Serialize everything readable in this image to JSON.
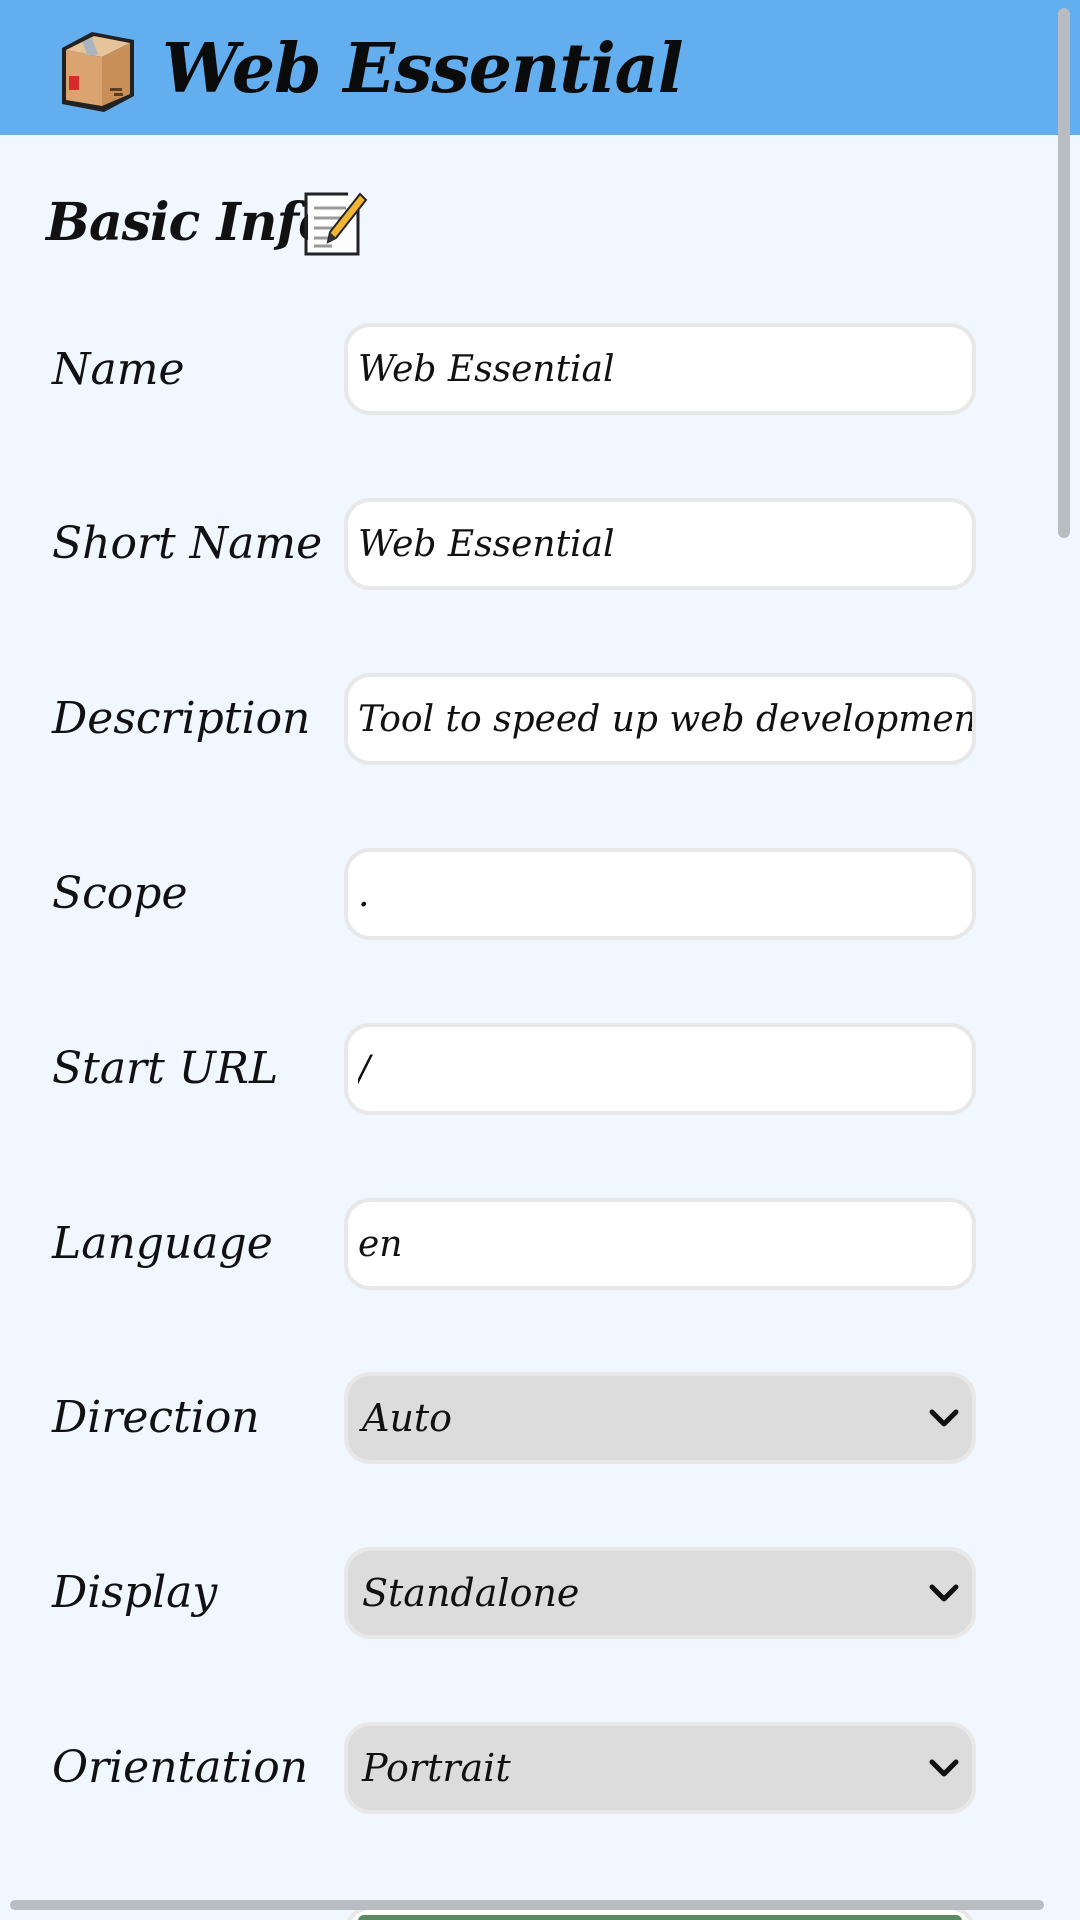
{
  "app": {
    "title": "Web Essential",
    "header_color": "#62aeee",
    "background_color": "#f0f7ff",
    "logo_icon": "package-box-icon"
  },
  "section": {
    "title": "Basic Info",
    "icon": "memo-pencil-icon"
  },
  "fields": {
    "name": {
      "label": "Name",
      "value": "Web Essential"
    },
    "short_name": {
      "label": "Short Name",
      "value": "Web Essential"
    },
    "description": {
      "label": "Description",
      "value": "Tool to speed up web development"
    },
    "scope": {
      "label": "Scope",
      "value": "."
    },
    "start_url": {
      "label": "Start URL",
      "value": "/"
    },
    "language": {
      "label": "Language",
      "value": "en"
    },
    "direction": {
      "label": "Direction",
      "value": "Auto",
      "icon": "chevron-down-icon"
    },
    "display": {
      "label": "Display",
      "value": "Standalone",
      "icon": "chevron-down-icon"
    },
    "orientation": {
      "label": "Orientation",
      "value": "Portrait",
      "icon": "chevron-down-icon"
    }
  },
  "partially_visible_field": {
    "swatch_color": "#5b8c61"
  }
}
